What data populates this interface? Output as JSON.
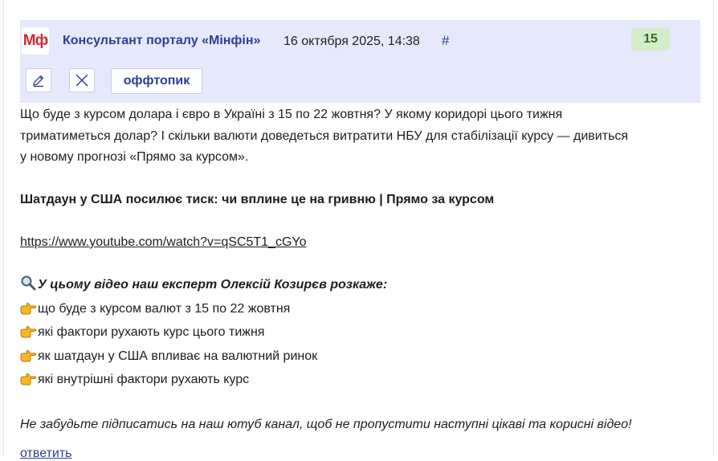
{
  "post": {
    "logo_text": "Мф",
    "author": "Консультант порталу «Мінфін»",
    "date": "16 октября 2025, 14:38",
    "anchor": "#",
    "score": "15",
    "tag": "оффтопик"
  },
  "content": {
    "intro_1": "Що буде з курсом долара і євро в Україні з 15 по 22 жовтня? У якому коридорі цього тижня",
    "intro_2": "триматиметься долар? І скільки валюти доведеться витратити НБУ для стабілізації курсу — дивиться",
    "intro_3": "у новому прогнозі «Прямо за курсом».",
    "headline": "Шатдаун у США посилює тиск: чи вплине це на гривню | Прямо за курсом",
    "url": "https://www.youtube.com/watch?v=qSC5T1_cGYo",
    "list_title": "У цьому відео наш експерт Олексій Козирєв розкаже:",
    "items": [
      "що буде з курсом валют з 15 по 22 жовтня",
      "які фактори рухають курс цього тижня",
      "як шатдаун у США впливає на валютний ринок",
      "які внутрішні фактори рухають курс"
    ],
    "footer_note": "Не забудьте підписатись на наш ютуб канал, щоб не пропустити наступні цікаві та корисні відео!"
  },
  "actions": {
    "reply": "ответить"
  },
  "colors": {
    "header_bg": "#e6e9fb",
    "accent": "#2b3f94",
    "score_bg": "#d3ecc9",
    "logo_red": "#d6282f"
  },
  "icons": {
    "edit": "pencil-icon",
    "close": "close-icon",
    "search": "magnifier-icon",
    "pointer": "pointing-hand-icon"
  }
}
